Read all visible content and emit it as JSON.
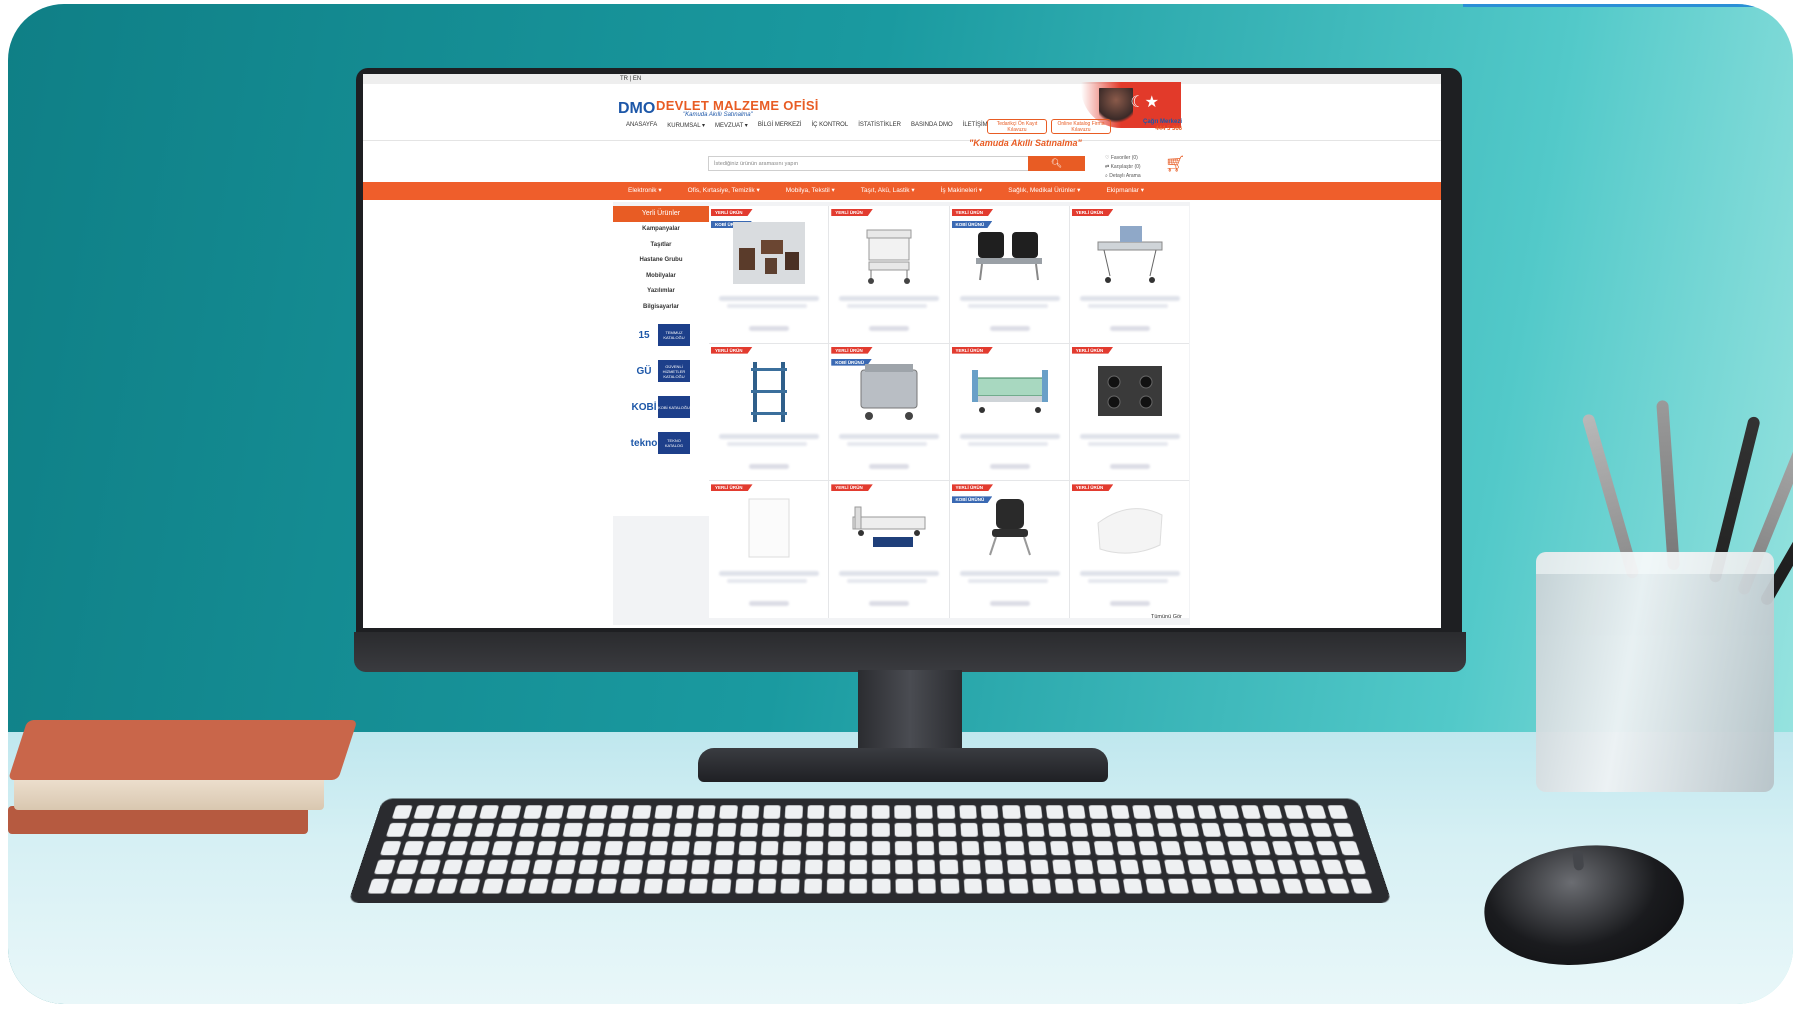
{
  "site": {
    "lang": "TR | EN",
    "logo_text": "DMO",
    "brand": "DEVLET MALZEME OFİSİ",
    "tagline": "\"Kamuda Akıllı Satınalma\"",
    "slogan": "\"Kamuda Akıllı Satınalma\""
  },
  "mainnav": [
    "ANASAYFA",
    "KURUMSAL ▾",
    "MEVZUAT ▾",
    "BİLGİ MERKEZİ",
    "İÇ KONTROL",
    "İSTATİSTİKLER",
    "BASINDA DMO",
    "İLETİŞİM"
  ],
  "header_buttons": {
    "preregistration": "Tedarikçi Ön Kayıt Kılavuzu",
    "catalog": "Online Katalog Firma Kılavuzu",
    "callcenter_label": "Çağrı Merkezi",
    "callcenter_number": "444 5 366"
  },
  "search": {
    "placeholder": "İstediğiniz ürünün aramasını yapın",
    "button_icon": "search-icon"
  },
  "quick_links": [
    "Favoriler (0)",
    "Karşılaştır (0)",
    "Detaylı Arama"
  ],
  "categories": [
    "Elektronik ▾",
    "Ofis, Kırtasiye, Temizlik ▾",
    "Mobilya, Tekstil ▾",
    "Taşıt, Akü, Lastik ▾",
    "İş Makineleri ▾",
    "Sağlık, Medikal Ürünler ▾",
    "Ekipmanlar ▾"
  ],
  "sidebar": {
    "header": "Yerli Ürünler",
    "items": [
      "Kampanyalar",
      "Taşıtlar",
      "Hastane Grubu",
      "Mobilyalar",
      "Yazılımlar",
      "Bilgisayarlar"
    ],
    "badges": [
      {
        "mark": "15",
        "label": "TEMMUZ KATALOĞU"
      },
      {
        "mark": "GÜ",
        "label": "GÜVENLİ HİZMETLER KATALOĞU"
      },
      {
        "mark": "KOBİ",
        "label": "KOBİ KATALOĞU"
      },
      {
        "mark": "tekno",
        "label": "TEKNO KATALOG"
      }
    ]
  },
  "product_tags": {
    "new": "YERLİ ÜRÜN",
    "local": "KOBİ ÜRÜNÜ"
  },
  "products": [
    {
      "kind": "furniture-set",
      "kobi": true
    },
    {
      "kind": "medical-cart",
      "kobi": false
    },
    {
      "kind": "waiting-chairs",
      "kobi": true
    },
    {
      "kind": "stretcher",
      "kobi": false
    },
    {
      "kind": "metal-shelf",
      "kobi": false
    },
    {
      "kind": "steel-tank",
      "kobi": true
    },
    {
      "kind": "hospital-bed",
      "kobi": false
    },
    {
      "kind": "gas-stove",
      "kobi": false
    },
    {
      "kind": "sheet",
      "kobi": false
    },
    {
      "kind": "electric-bed",
      "kobi": false
    },
    {
      "kind": "office-chair",
      "kobi": true
    },
    {
      "kind": "pillow",
      "kobi": false
    }
  ],
  "see_all": "Tümünü Gör",
  "colors": {
    "accent": "#e85c24",
    "brand_blue": "#1d57a8",
    "tag_red": "#e23b2f",
    "tag_blue": "#3a69b3"
  }
}
